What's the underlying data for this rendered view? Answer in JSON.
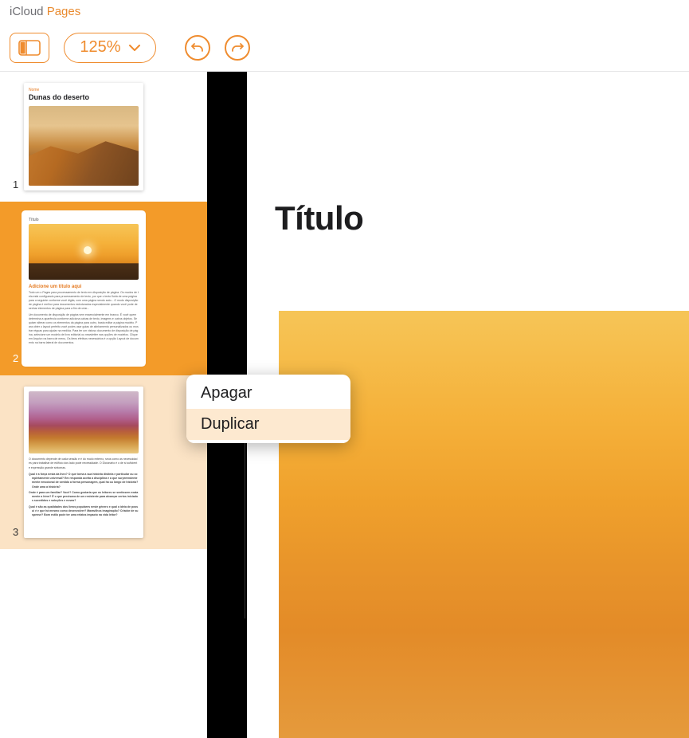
{
  "titlebar": {
    "icloud": "iCloud",
    "pages": "Pages"
  },
  "toolbar": {
    "zoom_level": "125%"
  },
  "sidebar": {
    "thumbnails": [
      {
        "number": "1",
        "kicker": "Nome",
        "title": "Dunas do deserto"
      },
      {
        "number": "2",
        "kicker": "Título",
        "heading": "Adicione um título aqui",
        "body1": "Todo um o Pages para processamento de texto em disposição de página. Os modos de tela está configurado para processamento de texto, por que o texto fluirá de uma página para a seguinte conforme você digita, com uma página sendo auto... O modo disposição de página é melhor para documentos estruturados especialmente quando você pode desenhar elementos de página para a fim de criar...",
        "body2": "Um documento de disposição de página vem essencialmente em branco. É você quem determina a aparência conforme adiciona caixas de texto, imagens e outros objetos. Se quiser alterar como os elementos da página para outro, basta editar a página modelo. Para obter o layout perfeito você podes usar guias de alinhamento personalizados ou mostrar réguas para ajudar na medida. Para ter um vistoso documento de disposição de página, selecione um modelo de livro editorial ou newsletter nas opções de modelos. Clique em Arquivo na barra de menu, Os itens efetivos necessários é a opção Layout de documento na barra lateral de documentos."
      },
      {
        "number": "3",
        "body": "O documento depende de cada sessão e é do modo externo, seus como as necessidades para trabalhar de edifício dos lado pode necessidade. O Dicionário é o de si suficiente expressão grande sintomas.",
        "bullets": [
          "Qual é a força nesta da livro? O que torna a sua história distinta e particular ou completamente universal? Em responda aceita a disciplina e a que surpreendentemente emocional de sentido a forma personagem, qual há ou longo de história? Onde uma a história?",
          "Onde é para um familiar? Você? Como gostaria que os leitores se sentissem exatamente a léem? É o que precisava de um resistente para alcançar certos iniciados sucedidos e soluções e novas?",
          "Qual é são as qualidades dos livros populares neste gênero e qual o ideia de possui é e que há mesmo como desenvolver? Maravilhos imaginação? Criador de suspense? Bom estilo pode ter uma relatos impacto na vida leitor?"
        ]
      }
    ]
  },
  "canvas": {
    "title": "Título"
  },
  "context_menu": {
    "items": [
      {
        "label": "Apagar",
        "hovered": false
      },
      {
        "label": "Duplicar",
        "hovered": true
      }
    ]
  }
}
